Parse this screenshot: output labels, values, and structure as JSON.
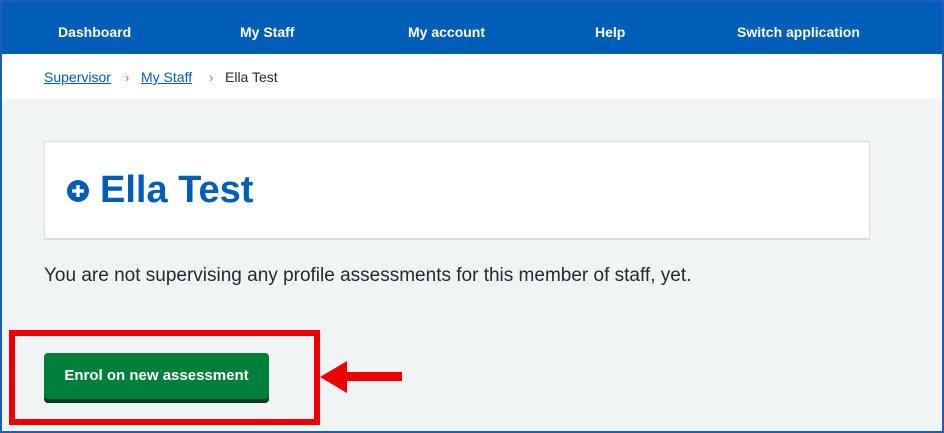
{
  "nav": {
    "items": [
      {
        "label": "Dashboard"
      },
      {
        "label": "My Staff"
      },
      {
        "label": "My account"
      },
      {
        "label": "Help"
      },
      {
        "label": "Switch application"
      }
    ]
  },
  "breadcrumb": {
    "items": [
      {
        "label": "Supervisor"
      },
      {
        "label": "My Staff"
      },
      {
        "label": "Ella Test"
      }
    ],
    "separator": "›"
  },
  "profile": {
    "name": "Ella Test",
    "icon": "plus-circle-icon"
  },
  "main": {
    "message": "You are not supervising any profile assessments for this member of staff, yet.",
    "enrol_label": "Enrol on new assessment"
  },
  "annotation": {
    "highlight_color": "#ee0000",
    "arrow_color": "#ee0000"
  },
  "colors": {
    "brand_blue": "#005eb8",
    "button_green": "#007f3b",
    "page_background": "#f0f4f5"
  }
}
